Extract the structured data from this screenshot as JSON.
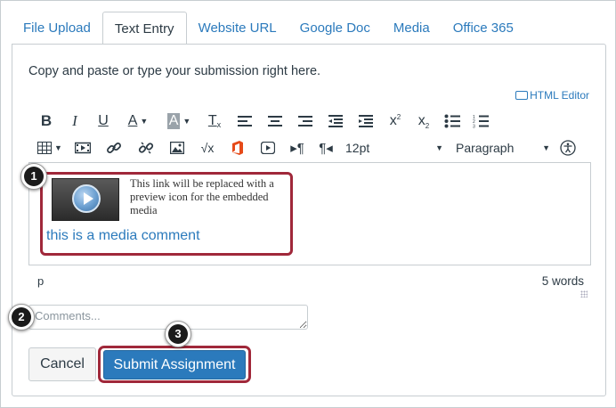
{
  "tabs": [
    {
      "label": "File Upload",
      "active": false
    },
    {
      "label": "Text Entry",
      "active": true
    },
    {
      "label": "Website URL",
      "active": false
    },
    {
      "label": "Google Doc",
      "active": false
    },
    {
      "label": "Media",
      "active": false
    },
    {
      "label": "Office 365",
      "active": false
    }
  ],
  "instructions": "Copy and paste or type your submission right here.",
  "html_editor_label": "HTML Editor",
  "toolbar": {
    "font_size": "12pt",
    "block_format": "Paragraph"
  },
  "editor": {
    "media_note": "This link will be replaced with a preview icon for the embedded media",
    "media_link": "this is a media comment"
  },
  "status": {
    "path": "p",
    "word_count": "5 words"
  },
  "comments": {
    "placeholder": "Comments..."
  },
  "buttons": {
    "cancel": "Cancel",
    "submit": "Submit Assignment"
  },
  "callouts": [
    "1",
    "2",
    "3"
  ],
  "colors": {
    "accent": "#2b7abc",
    "highlight": "#a0283a"
  }
}
